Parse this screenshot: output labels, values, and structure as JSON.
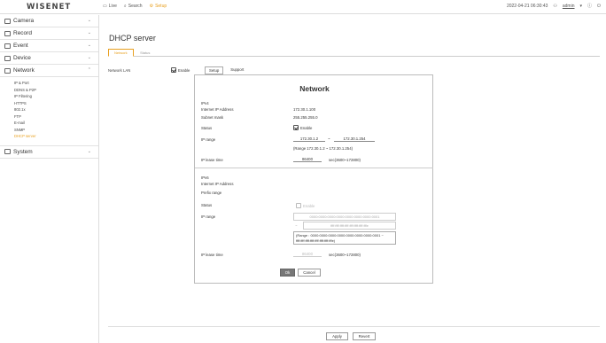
{
  "app": {
    "logo": "WISENET"
  },
  "topnav": {
    "live": "Live",
    "search": "Search",
    "setup": "Setup"
  },
  "topright": {
    "datetime": "2022-04-21 06:30:43",
    "user": "admin"
  },
  "sidebar": {
    "items": [
      {
        "label": "Camera"
      },
      {
        "label": "Record"
      },
      {
        "label": "Event"
      },
      {
        "label": "Device"
      },
      {
        "label": "Network"
      }
    ],
    "network_sub": [
      "IP & Port",
      "DDNS & P2P",
      "IP Filtering",
      "HTTPS",
      "802.1x",
      "FTP",
      "E-mail",
      "SNMP",
      "DHCP server"
    ],
    "system": {
      "label": "System"
    }
  },
  "page": {
    "title": "DHCP server",
    "tabs": [
      "Network",
      "Status"
    ],
    "network_lan_label": "Network LAN",
    "enable_label": "Enable",
    "subtabs": [
      "Setup",
      "Support"
    ]
  },
  "panel": {
    "title": "Network",
    "ipv4": {
      "section": "IPv4",
      "ip_label": "Internet IP Address",
      "ip_value": "172.30.1.100",
      "mask_label": "Subnet mask",
      "mask_value": "255.255.255.0",
      "status_label": "Status",
      "status_value": "Enable",
      "range_label": "IP range",
      "range_from": "172.30.1.2",
      "range_sep": "~",
      "range_to": "172.30.1.254",
      "range_note": "(Range 172.30.1.2 ~ 172.30.1.254)",
      "lease_label": "IP lease time",
      "lease_value": "86400",
      "lease_unit": "sec(3600~172800)"
    },
    "ipv6": {
      "section": "IPv6",
      "ip_label": "Internet IP Address",
      "prefix_label": "Prefix range",
      "status_label": "Status",
      "status_value": "Enable",
      "range_label": "IP range",
      "range_from": "0000:0000:0000:0000:0000:0000:0000:0001",
      "range_sep": "~",
      "range_to": "ffff:ffff:ffff:ffff:ffff:ffff:ffff:fffe",
      "range_note": "(Range : 0000:0000:0000:0000:0000:0000:0000:0001 ~ ffff:ffff:ffff:ffff:ffff:ffff:ffff:fffe)",
      "lease_label": "IP lease time",
      "lease_value": "86400",
      "lease_unit": "sec(3600~172800)"
    },
    "ok_label": "Ok",
    "cancel_label": "Cancel"
  },
  "footer": {
    "apply_label": "Apply",
    "revert_label": "Revert"
  },
  "colors": {
    "accent": "#e8a020"
  }
}
